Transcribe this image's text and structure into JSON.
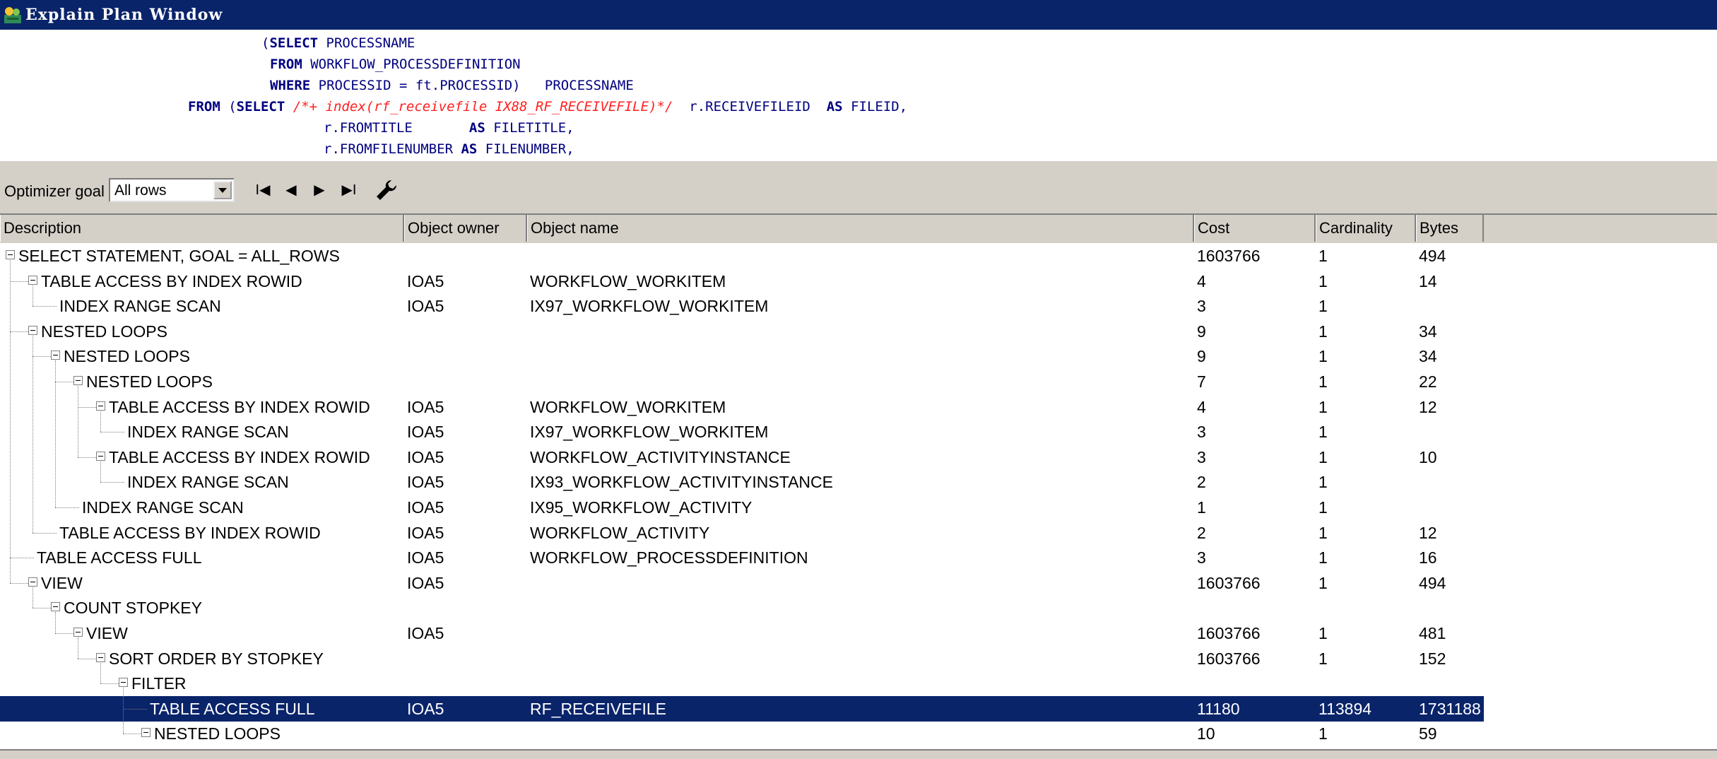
{
  "window": {
    "title": "Explain Plan Window"
  },
  "sql": {
    "lines": [
      [
        {
          "t": "(",
          "c": ""
        },
        {
          "t": "SELECT",
          "c": "kw"
        },
        {
          "t": " PROCESSNAME",
          "c": ""
        }
      ],
      [
        {
          "t": "FROM",
          "c": "kw"
        },
        {
          "t": " WORKFLOW_PROCESSDEFINITION",
          "c": ""
        }
      ],
      [
        {
          "t": "WHERE",
          "c": "kw"
        },
        {
          "t": " PROCESSID = ft.PROCESSID)   PROCESSNAME",
          "c": ""
        }
      ],
      [
        {
          "t": "FROM",
          "c": "kw"
        },
        {
          "t": " (",
          "c": ""
        },
        {
          "t": "SELECT",
          "c": "kw"
        },
        {
          "t": " ",
          "c": ""
        },
        {
          "t": "/*+ index(rf_receivefile IX88_RF_RECEIVEFILE)*/",
          "c": "hint"
        },
        {
          "t": "  r.RECEIVEFILEID  ",
          "c": ""
        },
        {
          "t": "AS",
          "c": "kw"
        },
        {
          "t": " FILEID,",
          "c": ""
        }
      ],
      [
        {
          "t": "r.FROMTITLE       ",
          "c": ""
        },
        {
          "t": "AS",
          "c": "kw"
        },
        {
          "t": " FILETITLE,",
          "c": ""
        }
      ],
      [
        {
          "t": "r.FROMFILENUMBER ",
          "c": ""
        },
        {
          "t": "AS",
          "c": "kw"
        },
        {
          "t": " FILENUMBER,",
          "c": ""
        }
      ]
    ]
  },
  "toolbar": {
    "optimizer_label": "Optimizer goal",
    "optimizer_value": "All rows",
    "nav_first": "I◀",
    "nav_prev": "◀",
    "nav_next": "▶",
    "nav_last": "▶I",
    "settings_icon": "wrench-icon"
  },
  "columns": [
    "Description",
    "Object owner",
    "Object name",
    "Cost",
    "Cardinality",
    "Bytes"
  ],
  "rows": [
    {
      "desc": "SELECT STATEMENT, GOAL = ALL_ROWS",
      "owner": "",
      "name": "",
      "cost": "1603766",
      "card": "1",
      "bytes": "494",
      "level": 0,
      "exp": true
    },
    {
      "desc": "TABLE ACCESS BY INDEX ROWID",
      "owner": "IOA5",
      "name": "WORKFLOW_WORKITEM",
      "cost": "4",
      "card": "1",
      "bytes": "14",
      "level": 1,
      "exp": true
    },
    {
      "desc": "INDEX RANGE SCAN",
      "owner": "IOA5",
      "name": "IX97_WORKFLOW_WORKITEM",
      "cost": "3",
      "card": "1",
      "bytes": "",
      "level": 2,
      "exp": false
    },
    {
      "desc": "NESTED LOOPS",
      "owner": "",
      "name": "",
      "cost": "9",
      "card": "1",
      "bytes": "34",
      "level": 1,
      "exp": true
    },
    {
      "desc": "NESTED LOOPS",
      "owner": "",
      "name": "",
      "cost": "9",
      "card": "1",
      "bytes": "34",
      "level": 2,
      "exp": true
    },
    {
      "desc": "NESTED LOOPS",
      "owner": "",
      "name": "",
      "cost": "7",
      "card": "1",
      "bytes": "22",
      "level": 3,
      "exp": true
    },
    {
      "desc": "TABLE ACCESS BY INDEX ROWID",
      "owner": "IOA5",
      "name": "WORKFLOW_WORKITEM",
      "cost": "4",
      "card": "1",
      "bytes": "12",
      "level": 4,
      "exp": true
    },
    {
      "desc": "INDEX RANGE SCAN",
      "owner": "IOA5",
      "name": "IX97_WORKFLOW_WORKITEM",
      "cost": "3",
      "card": "1",
      "bytes": "",
      "level": 5,
      "exp": false
    },
    {
      "desc": "TABLE ACCESS BY INDEX ROWID",
      "owner": "IOA5",
      "name": "WORKFLOW_ACTIVITYINSTANCE",
      "cost": "3",
      "card": "1",
      "bytes": "10",
      "level": 4,
      "exp": true
    },
    {
      "desc": "INDEX RANGE SCAN",
      "owner": "IOA5",
      "name": "IX93_WORKFLOW_ACTIVITYINSTANCE",
      "cost": "2",
      "card": "1",
      "bytes": "",
      "level": 5,
      "exp": false
    },
    {
      "desc": "INDEX RANGE SCAN",
      "owner": "IOA5",
      "name": "IX95_WORKFLOW_ACTIVITY",
      "cost": "1",
      "card": "1",
      "bytes": "",
      "level": 3,
      "exp": false
    },
    {
      "desc": "TABLE ACCESS BY INDEX ROWID",
      "owner": "IOA5",
      "name": "WORKFLOW_ACTIVITY",
      "cost": "2",
      "card": "1",
      "bytes": "12",
      "level": 2,
      "exp": false
    },
    {
      "desc": "TABLE ACCESS FULL",
      "owner": "IOA5",
      "name": "WORKFLOW_PROCESSDEFINITION",
      "cost": "3",
      "card": "1",
      "bytes": "16",
      "level": 1,
      "exp": false
    },
    {
      "desc": "VIEW",
      "owner": "IOA5",
      "name": "",
      "cost": "1603766",
      "card": "1",
      "bytes": "494",
      "level": 1,
      "exp": true
    },
    {
      "desc": "COUNT STOPKEY",
      "owner": "",
      "name": "",
      "cost": "",
      "card": "",
      "bytes": "",
      "level": 2,
      "exp": true
    },
    {
      "desc": "VIEW",
      "owner": "IOA5",
      "name": "",
      "cost": "1603766",
      "card": "1",
      "bytes": "481",
      "level": 3,
      "exp": true
    },
    {
      "desc": "SORT ORDER BY STOPKEY",
      "owner": "",
      "name": "",
      "cost": "1603766",
      "card": "1",
      "bytes": "152",
      "level": 4,
      "exp": true
    },
    {
      "desc": "FILTER",
      "owner": "",
      "name": "",
      "cost": "",
      "card": "",
      "bytes": "",
      "level": 5,
      "exp": true
    },
    {
      "desc": "TABLE ACCESS FULL",
      "owner": "IOA5",
      "name": "RF_RECEIVEFILE",
      "cost": "11180",
      "card": "113894",
      "bytes": "1731188",
      "level": 6,
      "exp": false,
      "selected": true
    },
    {
      "desc": "NESTED LOOPS",
      "owner": "",
      "name": "",
      "cost": "10",
      "card": "1",
      "bytes": "59",
      "level": 6,
      "exp": true
    }
  ]
}
